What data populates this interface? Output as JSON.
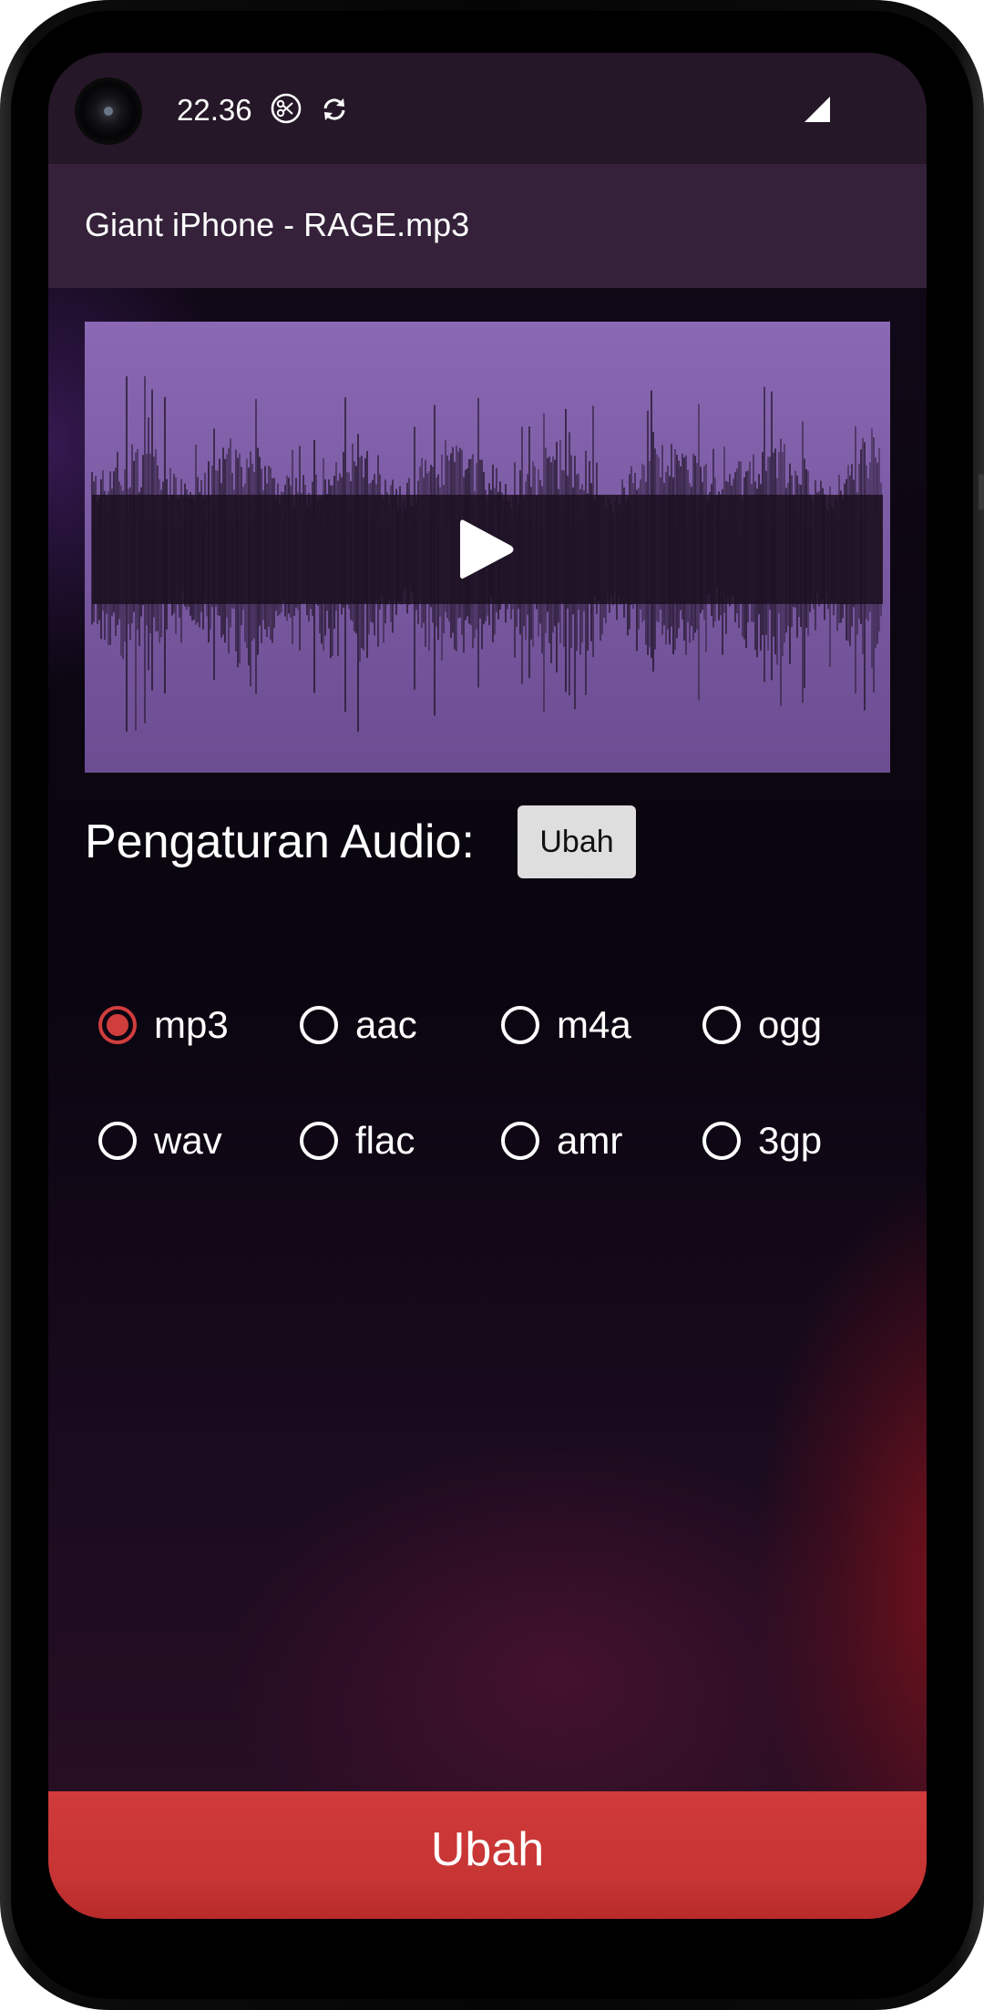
{
  "status_bar": {
    "time": "22.36",
    "icons": [
      "scissors-circle-icon",
      "sync-icon",
      "signal-icon"
    ]
  },
  "app_bar": {
    "title": "Giant iPhone - RAGE.mp3"
  },
  "player": {
    "play_icon": "play-icon"
  },
  "settings": {
    "label": "Pengaturan Audio:",
    "change_button": "Ubah"
  },
  "formats": {
    "row1": [
      {
        "label": "mp3",
        "checked": true
      },
      {
        "label": "aac",
        "checked": false
      },
      {
        "label": "m4a",
        "checked": false
      },
      {
        "label": "ogg",
        "checked": false
      }
    ],
    "row2": [
      {
        "label": "wav",
        "checked": false
      },
      {
        "label": "flac",
        "checked": false
      },
      {
        "label": "amr",
        "checked": false
      },
      {
        "label": "3gp",
        "checked": false
      }
    ]
  },
  "bottom_button": {
    "label": "Ubah"
  },
  "colors": {
    "accent": "#d03d3d",
    "app_bar": "#35223a",
    "status_bar": "#251727",
    "waveform_bg": "#7b5ba2"
  }
}
